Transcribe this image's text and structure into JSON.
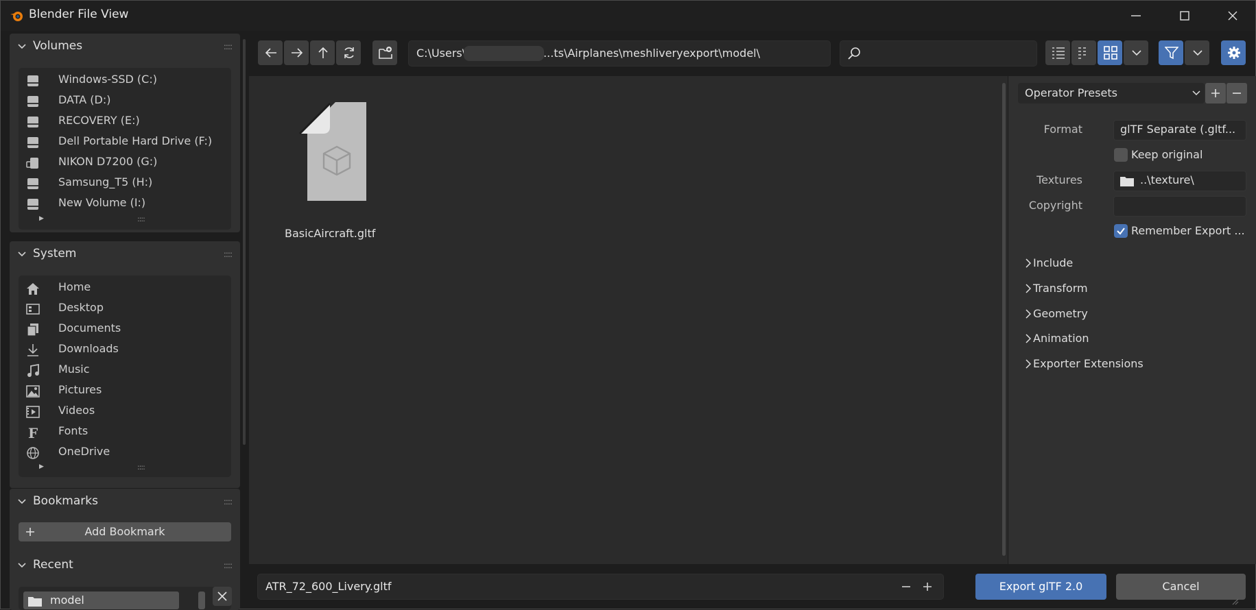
{
  "window": {
    "title": "Blender File View"
  },
  "volumes": {
    "header": "Volumes",
    "items": [
      {
        "label": "Windows-SSD (C:)",
        "icon": "drive-icon"
      },
      {
        "label": "DATA (D:)",
        "icon": "drive-icon"
      },
      {
        "label": "RECOVERY (E:)",
        "icon": "drive-icon"
      },
      {
        "label": "Dell Portable Hard Drive (F:)",
        "icon": "drive-icon"
      },
      {
        "label": "NIKON D7200 (G:)",
        "icon": "usb-drive-icon"
      },
      {
        "label": "Samsung_T5 (H:)",
        "icon": "drive-icon"
      },
      {
        "label": "New Volume (I:)",
        "icon": "drive-icon"
      }
    ]
  },
  "system": {
    "header": "System",
    "items": [
      {
        "label": "Home",
        "icon": "home-icon"
      },
      {
        "label": "Desktop",
        "icon": "desktop-icon"
      },
      {
        "label": "Documents",
        "icon": "documents-icon"
      },
      {
        "label": "Downloads",
        "icon": "download-icon"
      },
      {
        "label": "Music",
        "icon": "music-icon"
      },
      {
        "label": "Pictures",
        "icon": "pictures-icon"
      },
      {
        "label": "Videos",
        "icon": "videos-icon"
      },
      {
        "label": "Fonts",
        "icon": "fonts-icon"
      },
      {
        "label": "OneDrive",
        "icon": "globe-icon"
      }
    ]
  },
  "bookmarks": {
    "header": "Bookmarks",
    "add_label": "Add Bookmark"
  },
  "recent": {
    "header": "Recent",
    "items": [
      {
        "label": "model"
      }
    ]
  },
  "toolbar": {
    "path": "C:\\Users\\            \\OneDrive\\Do...ts\\Airplanes\\meshliveryexport\\model\\",
    "search_placeholder": ""
  },
  "files": [
    {
      "name": "BasicAircraft.gltf",
      "icon": "3d-file-icon"
    }
  ],
  "properties": {
    "presets_label": "Operator Presets",
    "format_label": "Format",
    "format_value": "glTF Separate (.gltf...",
    "keep_original_label": "Keep original",
    "keep_original_checked": false,
    "textures_label": "Textures",
    "textures_value": "..\\texture\\",
    "copyright_label": "Copyright",
    "copyright_value": "",
    "remember_label": "Remember Export ...",
    "remember_checked": true,
    "sections": [
      "Include",
      "Transform",
      "Geometry",
      "Animation",
      "Exporter Extensions"
    ]
  },
  "footer": {
    "filename": "ATR_72_600_Livery.gltf",
    "export_label": "Export glTF 2.0",
    "cancel_label": "Cancel"
  },
  "colors": {
    "accent": "#4772b3",
    "panel": "#303030",
    "background": "#1d1d1d"
  }
}
